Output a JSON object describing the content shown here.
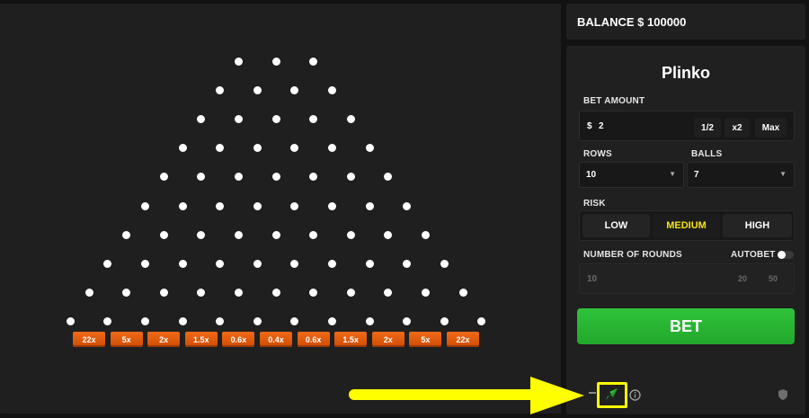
{
  "balance": {
    "label": "BALANCE $ 100000"
  },
  "panel": {
    "title": "Plinko",
    "bet_amount": {
      "label": "BET AMOUNT",
      "currency": "$",
      "value": "2",
      "half": "1/2",
      "double": "x2",
      "max": "Max"
    },
    "rows": {
      "label": "ROWS",
      "value": "10"
    },
    "balls": {
      "label": "BALLS",
      "value": "7"
    },
    "risk": {
      "label": "RISK",
      "options": [
        "LOW",
        "MEDIUM",
        "HIGH"
      ],
      "selected": "MEDIUM"
    },
    "rounds": {
      "label": "NUMBER OF ROUNDS",
      "value": "10",
      "opt1": "20",
      "opt2": "50"
    },
    "autobet": {
      "label": "AUTOBET",
      "on": false
    },
    "bet_button": "BET"
  },
  "board": {
    "rows": 10,
    "multipliers": [
      "22x",
      "5x",
      "2x",
      "1.5x",
      "0.6x",
      "0.4x",
      "0.6x",
      "1.5x",
      "2x",
      "5x",
      "22x"
    ]
  },
  "footer_icons": [
    "rocket-icon",
    "info-icon",
    "shield-icon"
  ],
  "colors": {
    "accent_yellow": "#f5e218",
    "bet_green": "#27b431",
    "multiplier_orange": "#e85d0d",
    "annotation_yellow": "#ffff00"
  }
}
